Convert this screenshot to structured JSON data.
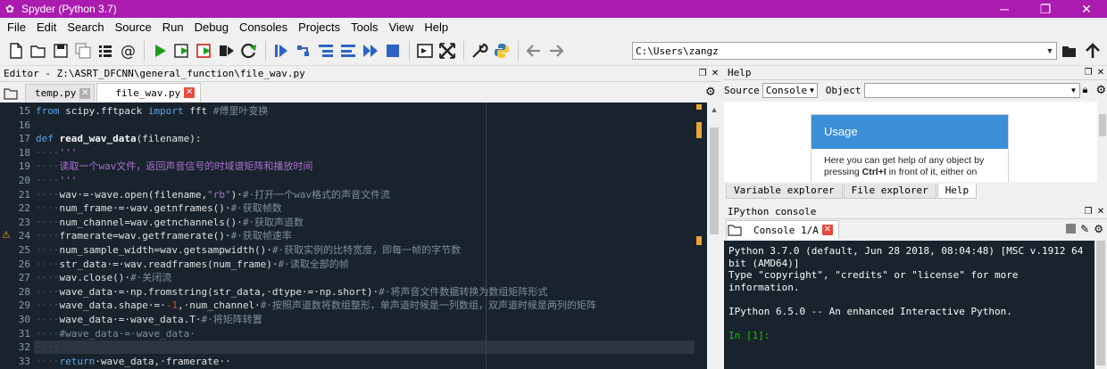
{
  "window": {
    "title": "Spyder (Python 3.7)",
    "minimize": "─",
    "maximize": "❐",
    "close": "✕",
    "title_bar_color": "#ab1baf"
  },
  "menu": [
    "File",
    "Edit",
    "Search",
    "Source",
    "Run",
    "Debug",
    "Consoles",
    "Projects",
    "Tools",
    "View",
    "Help"
  ],
  "toolbar": {
    "path": "C:\\Users\\zangz",
    "icons": [
      "new-file-icon",
      "open-file-icon",
      "save-icon",
      "save-all-icon",
      "browse-tabs-icon",
      "list-icon",
      "at-icon",
      "run-icon",
      "run-cell-icon",
      "run-cell-advance-icon",
      "run-selection-icon",
      "rerun-icon",
      "debug-icon",
      "step-icon",
      "step-into-icon",
      "step-return-icon",
      "continue-icon",
      "stop-icon",
      "maximize-pane-icon",
      "fullscreen-icon",
      "wrench-icon",
      "python-icon",
      "back-icon",
      "forward-icon",
      "browse-folder-icon",
      "up-arrow-icon"
    ]
  },
  "editor": {
    "header": "Editor - Z:\\ASRT_DFCNN\\general_function\\file_wav.py",
    "tabs": [
      {
        "label": "temp.py",
        "active": false
      },
      {
        "label": "file_wav.py",
        "active": true
      }
    ],
    "current_line": 32,
    "warning_line": 24,
    "lines": [
      {
        "n": "15",
        "segs": [
          [
            "kw",
            "from"
          ],
          [
            "lit",
            " scipy.fftpack "
          ],
          [
            "kw",
            "import"
          ],
          [
            "lit",
            " fft "
          ],
          [
            "cm",
            "#傅里叶变换"
          ]
        ]
      },
      {
        "n": "16",
        "segs": []
      },
      {
        "n": "17",
        "segs": [
          [
            "kw",
            "def"
          ],
          [
            "lit",
            " "
          ],
          [
            "fn",
            "read_wav_data"
          ],
          [
            "lit",
            "(filename):"
          ]
        ]
      },
      {
        "n": "18",
        "segs": [
          [
            "dot",
            "····"
          ],
          [
            "str",
            "'''"
          ]
        ]
      },
      {
        "n": "19",
        "segs": [
          [
            "dot",
            "····"
          ],
          [
            "str",
            "读取一个wav文件，返回声音信号的时域谱矩阵和播放时间"
          ]
        ]
      },
      {
        "n": "20",
        "segs": [
          [
            "dot",
            "····"
          ],
          [
            "str",
            "'''"
          ]
        ]
      },
      {
        "n": "21",
        "segs": [
          [
            "dot",
            "····"
          ],
          [
            "lit",
            "wav·=·wave.open(filename,"
          ],
          [
            "str",
            "\"rb\""
          ],
          [
            "lit",
            ")·"
          ],
          [
            "cm",
            "#·打开一个wav格式的声音文件流"
          ]
        ]
      },
      {
        "n": "22",
        "segs": [
          [
            "dot",
            "····"
          ],
          [
            "lit",
            "num_frame·=·wav.getnframes()·"
          ],
          [
            "cm",
            "#·获取帧数"
          ]
        ]
      },
      {
        "n": "23",
        "segs": [
          [
            "dot",
            "····"
          ],
          [
            "lit",
            "num_channel=wav.getnchannels()·"
          ],
          [
            "cm",
            "#·获取声道数"
          ]
        ]
      },
      {
        "n": "24",
        "segs": [
          [
            "dot",
            "····"
          ],
          [
            "lit",
            "framerate=wav.getframerate()·"
          ],
          [
            "cm",
            "#·获取帧速率"
          ]
        ]
      },
      {
        "n": "25",
        "segs": [
          [
            "dot",
            "····"
          ],
          [
            "lit",
            "num_sample_width=wav.getsampwidth()·"
          ],
          [
            "cm",
            "#·获取实例的比特宽度，即每一帧的字节数"
          ]
        ]
      },
      {
        "n": "26",
        "segs": [
          [
            "dot",
            "····"
          ],
          [
            "lit",
            "str_data·=·wav.readframes(num_frame)·"
          ],
          [
            "cm",
            "#·读取全部的帧"
          ]
        ]
      },
      {
        "n": "27",
        "segs": [
          [
            "dot",
            "····"
          ],
          [
            "lit",
            "wav.close()·"
          ],
          [
            "cm",
            "#·关闭流"
          ]
        ]
      },
      {
        "n": "28",
        "segs": [
          [
            "dot",
            "····"
          ],
          [
            "lit",
            "wave_data·=·np.fromstring(str_data,·dtype·=·np.short)·"
          ],
          [
            "cm",
            "#·将声音文件数据转换为数组矩阵形式"
          ]
        ]
      },
      {
        "n": "29",
        "segs": [
          [
            "dot",
            "····"
          ],
          [
            "lit",
            "wave_data.shape·=·"
          ],
          [
            "num",
            "-1"
          ],
          [
            "lit",
            ",·num_channel·"
          ],
          [
            "cm",
            "#·按照声道数将数组整形，单声道时候是一列数组，双声道时候是两列的矩阵"
          ]
        ]
      },
      {
        "n": "30",
        "segs": [
          [
            "dot",
            "····"
          ],
          [
            "lit",
            "wave_data·=·wave_data.T·"
          ],
          [
            "cm",
            "#·将矩阵转置"
          ]
        ]
      },
      {
        "n": "31",
        "segs": [
          [
            "dot",
            "····"
          ],
          [
            "cm",
            "#wave_data·=·wave_data·"
          ]
        ]
      },
      {
        "n": "32",
        "segs": [
          [
            "dot",
            "····"
          ]
        ]
      },
      {
        "n": "33",
        "segs": [
          [
            "dot",
            "····"
          ],
          [
            "kw",
            "return"
          ],
          [
            "lit",
            "·wave_data,·framerate··"
          ]
        ]
      }
    ]
  },
  "help": {
    "header": "Help",
    "source_label": "Source",
    "source_value": "Console",
    "object_label": "Object",
    "object_value": "",
    "usage_title": "Usage",
    "usage_text_1": "Here you can get help of any object by",
    "usage_text_2a": "pressing ",
    "usage_text_2b": "Ctrl+I",
    "usage_text_2c": " in front of it, either on",
    "tabs": [
      {
        "label": "Variable explorer",
        "active": false
      },
      {
        "label": "File explorer",
        "active": false
      },
      {
        "label": "Help",
        "active": true
      }
    ]
  },
  "console": {
    "header": "IPython console",
    "tab_label": "Console 1/A",
    "lines": [
      "Python 3.7.0 (default, Jun 28 2018, 08:04:48) [MSC v.1912 64 bit (AMD64)]",
      "Type \"copyright\", \"credits\" or \"license\" for more information.",
      "",
      "IPython 6.5.0 -- An enhanced Interactive Python.",
      ""
    ],
    "prompt": "In [1]:"
  }
}
